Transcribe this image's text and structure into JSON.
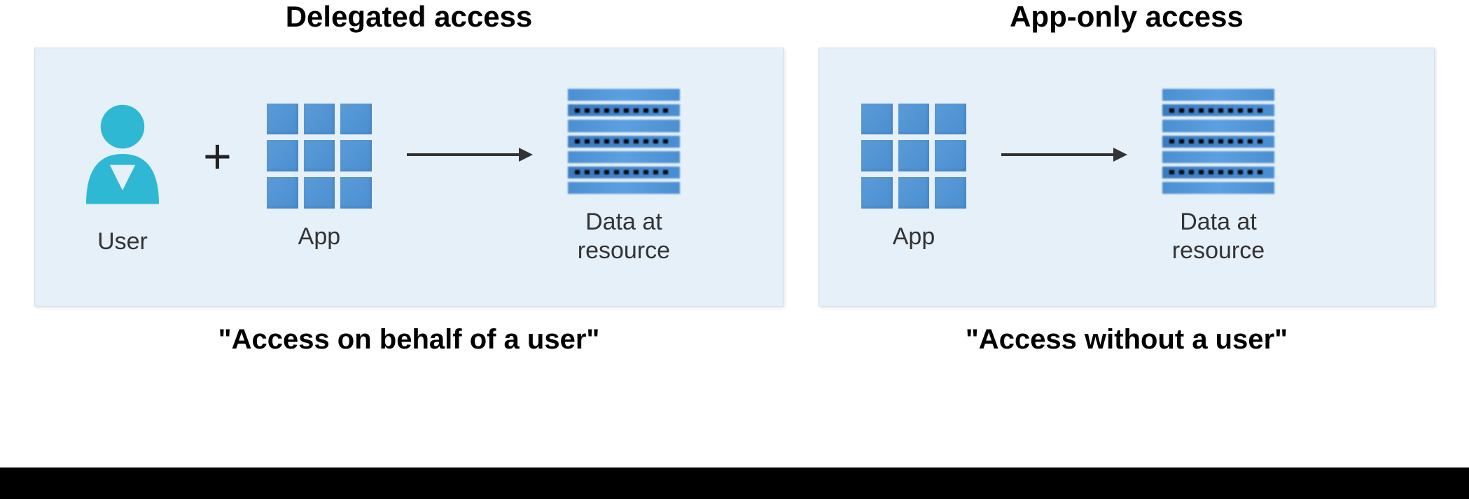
{
  "diagram": {
    "left": {
      "title": "Delegated access",
      "subtitle": "\"Access on behalf of a user\"",
      "items": {
        "user_label": "User",
        "app_label": "App",
        "data_label": "Data at\nresource"
      }
    },
    "right": {
      "title": "App-only access",
      "subtitle": "\"Access without a user\"",
      "items": {
        "app_label": "App",
        "data_label": "Data at\nresource"
      }
    }
  }
}
